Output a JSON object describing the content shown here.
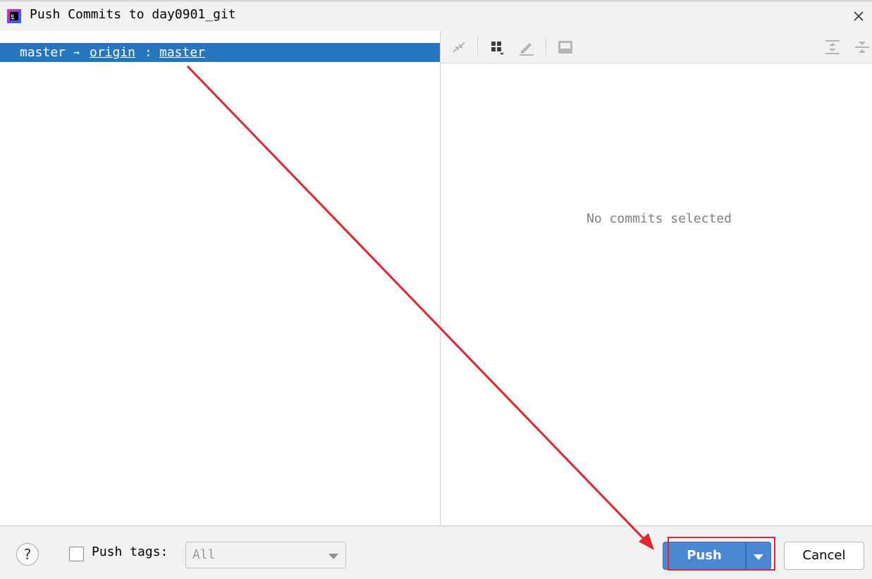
{
  "window": {
    "title": "Push Commits to day0901_git",
    "app_icon": "intellij-idea-icon",
    "close_icon": "close-icon"
  },
  "branch_row": {
    "local_branch": "master",
    "arrow": "→",
    "remote": "origin",
    "separator": ":",
    "remote_branch": "master"
  },
  "details": {
    "empty_message": "No commits selected",
    "toolbar_icons": [
      "collapse-icon",
      "group-by-icon",
      "edit-icon",
      "preview-icon",
      "expand-all-icon",
      "collapse-all-icon"
    ]
  },
  "footer": {
    "help_label": "?",
    "push_tags_label": "Push tags:",
    "push_tags_checked": false,
    "tags_select_value": "All",
    "push_button": "Push",
    "cancel_button": "Cancel"
  },
  "colors": {
    "selection": "#2675bf",
    "primary_button": "#4a88d2",
    "annotation": "#e0252d"
  }
}
